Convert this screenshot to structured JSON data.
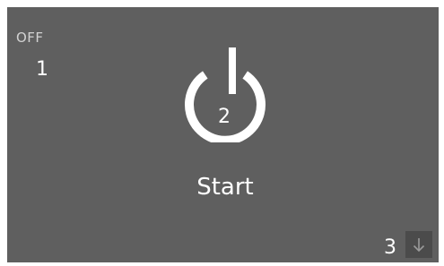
{
  "status": {
    "power_state": "OFF"
  },
  "power": {
    "label": "Start",
    "icon": "power-icon"
  },
  "nav": {
    "icon": "arrow-down-icon"
  },
  "callouts": {
    "one": "1",
    "two": "2",
    "three": "3"
  },
  "colors": {
    "background": "#5f5f5f",
    "foreground": "#ffffff",
    "status_text": "#d2d2d2",
    "scroll_button": "#4b4b4b"
  }
}
